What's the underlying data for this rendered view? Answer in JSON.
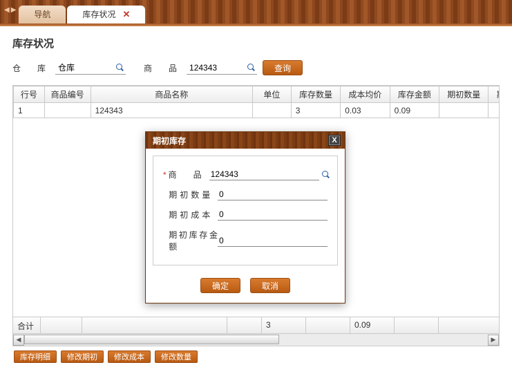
{
  "tabs": {
    "nav": "导航",
    "active": "库存状况"
  },
  "page": {
    "title": "库存状况"
  },
  "filter": {
    "warehouse_label": "仓　库",
    "warehouse_value": "仓库",
    "product_label": "商　品",
    "product_value": "124343",
    "query_btn": "查询"
  },
  "columns": {
    "rownum": "行号",
    "code": "商品编号",
    "name": "商品名称",
    "unit": "单位",
    "qty": "库存数量",
    "cost": "成本均价",
    "amt": "库存金额",
    "iqty": "期初数量",
    "icost": "期初成本"
  },
  "row": {
    "rownum": "1",
    "code": "",
    "name": "124343",
    "unit": "",
    "qty": "3",
    "cost": "0.03",
    "amt": "0.09",
    "iqty": "",
    "icost": ""
  },
  "totals": {
    "label": "合计",
    "qty": "3",
    "amt": "0.09"
  },
  "bottom_buttons": {
    "b1": "库存明细",
    "b2": "修改期初",
    "b3": "修改成本",
    "b4": "修改数量"
  },
  "dialog": {
    "title": "期初库存",
    "product_label": "商　　品",
    "product_value": "124343",
    "qty_label": "期初数量",
    "qty_value": "0",
    "cost_label": "期初成本",
    "cost_value": "0",
    "amt_label": "期初库存金额",
    "amt_value": "0",
    "ok": "确定",
    "cancel": "取消"
  }
}
